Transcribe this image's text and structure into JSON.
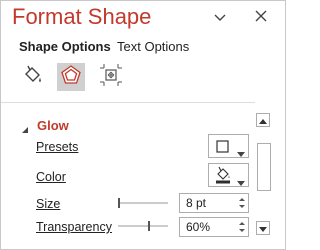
{
  "pane": {
    "title": "Format Shape",
    "dropdown_icon": "chevron-down-icon",
    "close_icon": "close-icon"
  },
  "tabs": [
    {
      "label": "Shape Options",
      "active": true
    },
    {
      "label": "Text Options",
      "active": false
    }
  ],
  "categories": [
    {
      "name": "fill-line-icon",
      "selected": false
    },
    {
      "name": "effects-pentagon-icon",
      "selected": true
    },
    {
      "name": "size-properties-icon",
      "selected": false
    }
  ],
  "glow": {
    "header": "Glow",
    "presets_label": "Presets",
    "color_label": "Color",
    "size_label": "Size",
    "size_value": "8 pt",
    "transparency_label": "Transparency",
    "transparency_value": "60%"
  },
  "colors": {
    "accent": "#c23a2c",
    "selected_bg": "#d0d0d0",
    "border": "#adadad",
    "glow_color_swatch": "#2f2f2f"
  }
}
